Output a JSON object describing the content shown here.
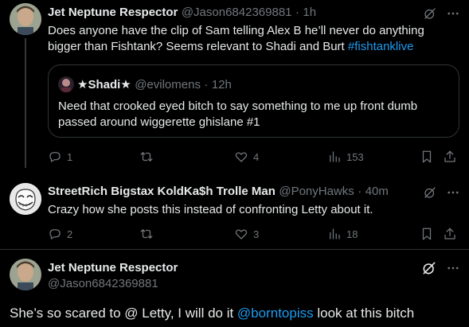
{
  "tweet1": {
    "name": "Jet Neptune Respector",
    "handle": "@Jason6842369881",
    "sep": "·",
    "time": "1h",
    "text_main": "Does anyone have the clip of Sam telling Alex B he’ll never do anything bigger than Fishtank? Seems relevant to Shadi and Burt ",
    "text_tag": "#fishtanklive",
    "quote": {
      "name": "★Shadi★",
      "handle": "@evilomens",
      "sep": "·",
      "time": "12h",
      "text": "Need that crooked eyed bitch to say something to me up front dumb passed around wiggerette ghislane #1"
    },
    "actions": {
      "replies": "1",
      "retweets": "",
      "likes": "4",
      "views": "153"
    }
  },
  "tweet2": {
    "name": "StreetRich Bigstax KoldKa$h Trolle Man",
    "handle": "@PonyHawks",
    "sep": "·",
    "time": "40m",
    "text": "Crazy how she posts this instead of confronting Letty about it.",
    "actions": {
      "replies": "2",
      "retweets": "",
      "likes": "3",
      "views": "18"
    }
  },
  "tweet3": {
    "name": "Jet Neptune Respector",
    "handle": "@Jason6842369881",
    "text_before": "She’s so scared to @ Letty, I will do it ",
    "mention": "@borntopiss",
    "text_after": " look at this bitch"
  },
  "icons": {
    "grok": "grok-icon",
    "more": "more-icon",
    "reply": "reply-icon",
    "retweet": "retweet-icon",
    "like": "heart-icon",
    "views": "views-icon",
    "bookmark": "bookmark-icon",
    "share": "share-icon"
  },
  "colors": {
    "background": "#000000",
    "text": "#e7e9ea",
    "secondary": "#71767b",
    "accent": "#1d9bf0",
    "border": "#2f3336"
  }
}
